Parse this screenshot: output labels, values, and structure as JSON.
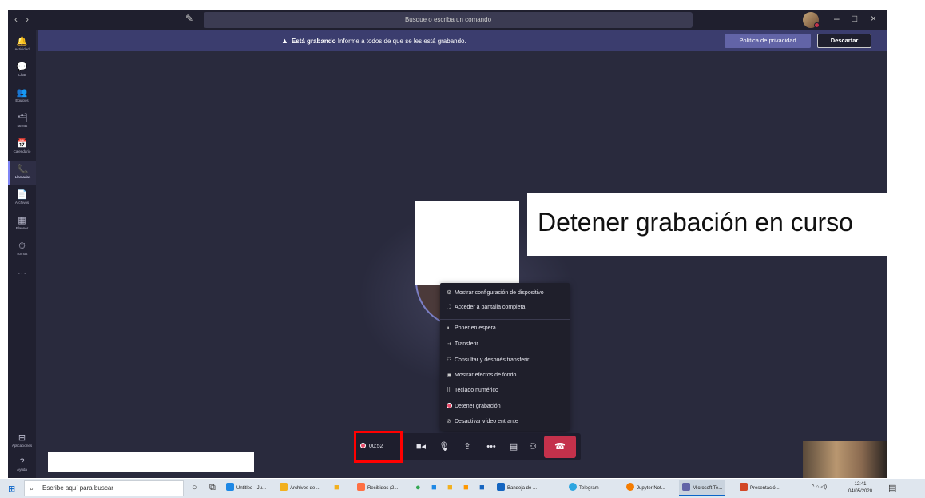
{
  "titlebar": {
    "back": "‹",
    "forward": "›",
    "search_placeholder": "Busque o escriba un comando",
    "minimize": "–",
    "maximize": "□",
    "close": "×"
  },
  "rail": {
    "items": [
      {
        "label": "Actividad",
        "icon": "🔔"
      },
      {
        "label": "Chat",
        "icon": "💬"
      },
      {
        "label": "Equipos",
        "icon": "👥"
      },
      {
        "label": "Tareas",
        "icon": "🗂"
      },
      {
        "label": "Calendario",
        "icon": "📅"
      },
      {
        "label": "Llamadas",
        "icon": "📞"
      },
      {
        "label": "Archivos",
        "icon": "📄"
      },
      {
        "label": "Planner",
        "icon": "▦"
      },
      {
        "label": "Turnos",
        "icon": "⏱"
      }
    ],
    "more": "···",
    "apps_label": "Aplicaciones",
    "help_label": "Ayuda"
  },
  "banner": {
    "bold": "Está grabando",
    "text": " Informe a todos de que se les está grabando.",
    "privacy_button": "Política de privacidad",
    "dismiss_button": "Descartar"
  },
  "menu": {
    "items": [
      "Mostrar configuración de dispositivo",
      "Acceder a pantalla completa",
      "Poner en espera",
      "Transferir",
      "Consultar y después transferir",
      "Mostrar efectos de fondo",
      "Teclado numérico",
      "Detener grabación",
      "Desactivar vídeo entrante"
    ]
  },
  "controls": {
    "timer": "00:52"
  },
  "callout": {
    "text": "Detener grabación en curso"
  },
  "taskbar": {
    "search_placeholder": "Escribe aquí para buscar",
    "apps": [
      {
        "label": "Untitled - Ju...",
        "color": "#1e88e5"
      },
      {
        "label": "Archivos de ...",
        "color": "#f2b01e"
      },
      {
        "label": "Recibidos (2...",
        "color": "#ff7043"
      },
      {
        "label": "Bandeja de ...",
        "color": "#1565c0"
      },
      {
        "label": "Telegram",
        "color": "#2ca5e0"
      },
      {
        "label": "Jupyter Not...",
        "color": "#f57c00"
      },
      {
        "label": "Microsoft Te...",
        "color": "#6264a7"
      },
      {
        "label": "Presentació...",
        "color": "#d24726"
      }
    ],
    "time": "12:41",
    "date": "04/05/2020"
  }
}
